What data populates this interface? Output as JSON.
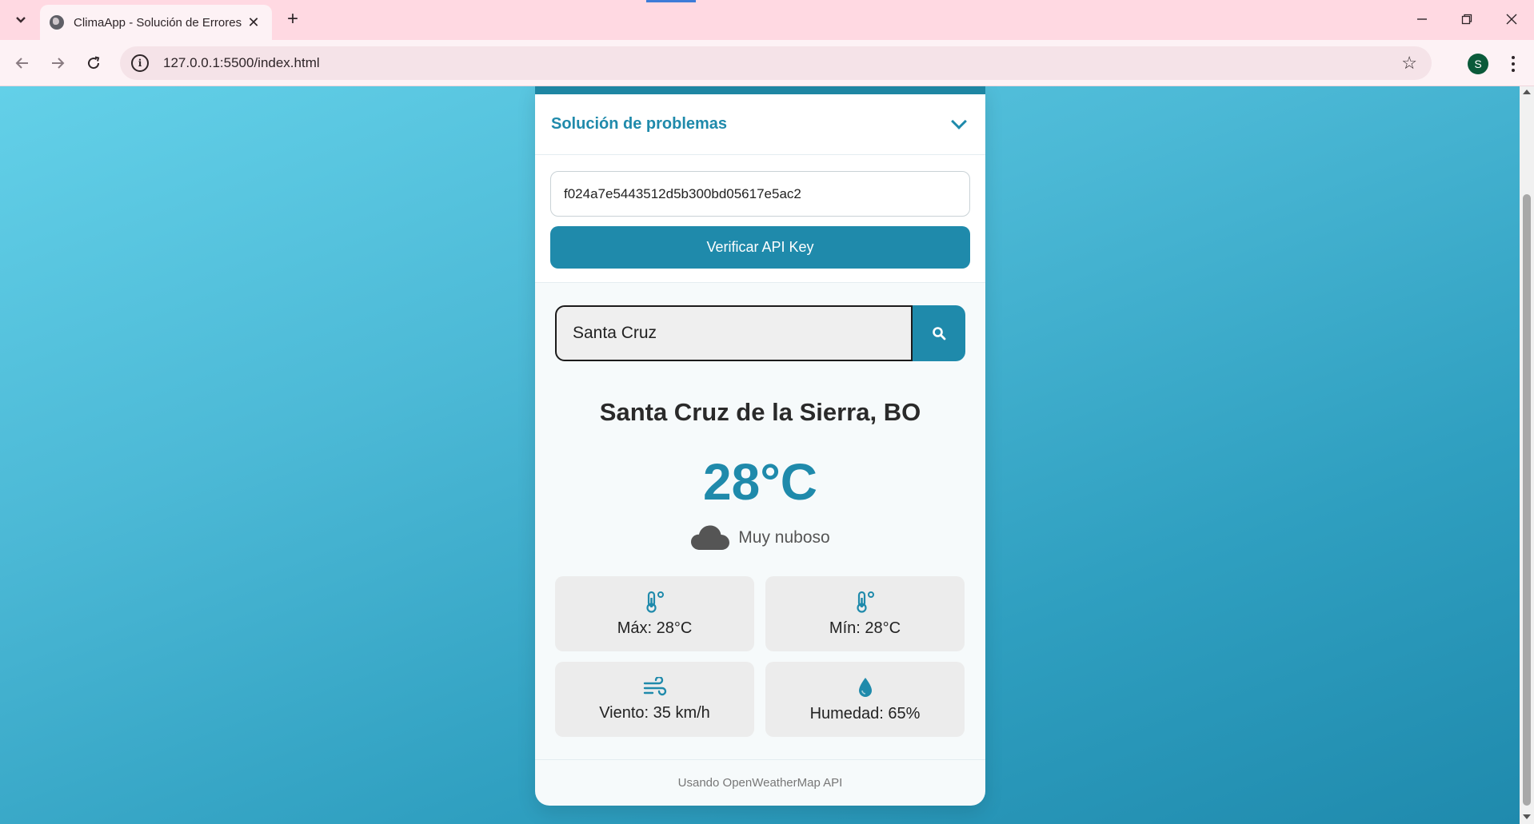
{
  "browser": {
    "tab_title": "ClimaApp - Solución de Errores",
    "url": "127.0.0.1:5500/index.html",
    "profile_initial": "S"
  },
  "troubleshoot": {
    "title": "Solución de problemas",
    "api_key_value": "f024a7e5443512d5b300bd05617e5ac2",
    "verify_button": "Verificar API Key"
  },
  "search": {
    "city_value": "Santa Cruz"
  },
  "weather": {
    "city": "Santa Cruz de la Sierra, BO",
    "temperature": "28°C",
    "condition": "Muy nuboso",
    "condition_icon": "cloud-icon",
    "max": "Máx: 28°C",
    "min": "Mín: 28°C",
    "wind": "Viento: 35 km/h",
    "humidity": "Humedad: 65%"
  },
  "footer": {
    "text": "Usando OpenWeatherMap API"
  },
  "colors": {
    "accent": "#1f8aab",
    "tab_bar": "#ffd9e2",
    "card": "#f6fafb"
  }
}
